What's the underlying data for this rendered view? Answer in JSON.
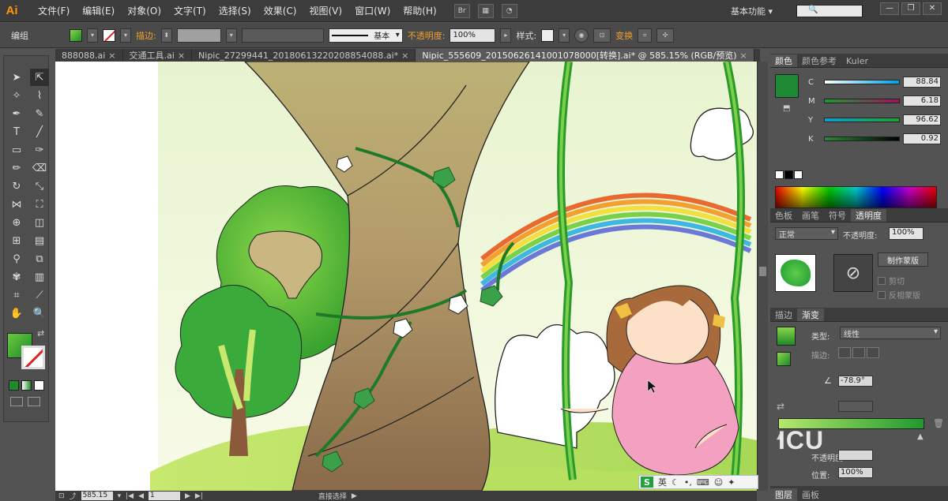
{
  "app": {
    "logo": "Ai"
  },
  "menu": [
    "文件(F)",
    "编辑(E)",
    "对象(O)",
    "文字(T)",
    "选择(S)",
    "效果(C)",
    "视图(V)",
    "窗口(W)",
    "帮助(H)"
  ],
  "menubar_icons": [
    "Br",
    "layout-icon",
    "gpu-icon"
  ],
  "workspace": {
    "label": "基本功能"
  },
  "window_controls": [
    "—",
    "❐",
    "✕"
  ],
  "control": {
    "object_type": "编组",
    "stroke_label": "描边:",
    "stroke_style": "基本",
    "opacity_label": "不透明度:",
    "opacity_value": "100%",
    "style_label": "样式:",
    "transform_label": "变换"
  },
  "doc_tabs": [
    {
      "label": "888088.ai",
      "active": false
    },
    {
      "label": "交通工具.ai",
      "active": false
    },
    {
      "label": "Nipic_27299441_20180613220208854088.ai*",
      "active": false
    },
    {
      "label": "Nipic_555609_20150626141001078000[转换].ai* @ 585.15% (RGB/预览)",
      "active": true
    }
  ],
  "status": {
    "zoom": "585.15",
    "page": "1",
    "tool": "直接选择"
  },
  "panels": {
    "color": {
      "tabs": [
        "颜色",
        "颜色参考",
        "Kuler"
      ],
      "fill_color": "#1e8a35",
      "cmyk": [
        {
          "label": "C",
          "value": "88.84",
          "track": "linear-gradient(90deg,#ffffff,#00a0e0)"
        },
        {
          "label": "M",
          "value": "6.18",
          "track": "linear-gradient(90deg,#1e9a35,#a01060)"
        },
        {
          "label": "Y",
          "value": "96.62",
          "track": "linear-gradient(90deg,#10a0d0,#20a030)"
        },
        {
          "label": "K",
          "value": "0.92",
          "track": "linear-gradient(90deg,#2a8a3a,#000000)"
        }
      ]
    },
    "transparency": {
      "tabs": [
        "色板",
        "画笔",
        "符号",
        "透明度"
      ],
      "blend_mode": "正常",
      "opacity_label": "不透明度:",
      "opacity_value": "100%",
      "make_mask": "制作蒙版",
      "clip": "剪切",
      "invert_mask": "反相蒙版"
    },
    "gradient": {
      "tabs": [
        "描边",
        "渐变"
      ],
      "type_label": "类型:",
      "type_value": "线性",
      "stroke_label": "描边:",
      "angle": "-78.9°",
      "opacity_label": "不透明度:",
      "opacity_value": "",
      "location_label": "位置:",
      "location_value": "100%"
    },
    "layers_tabs": [
      "图层",
      "画板"
    ]
  },
  "ime": {
    "badge": "S",
    "lang": "英"
  },
  "overlay_logo": "ICU"
}
